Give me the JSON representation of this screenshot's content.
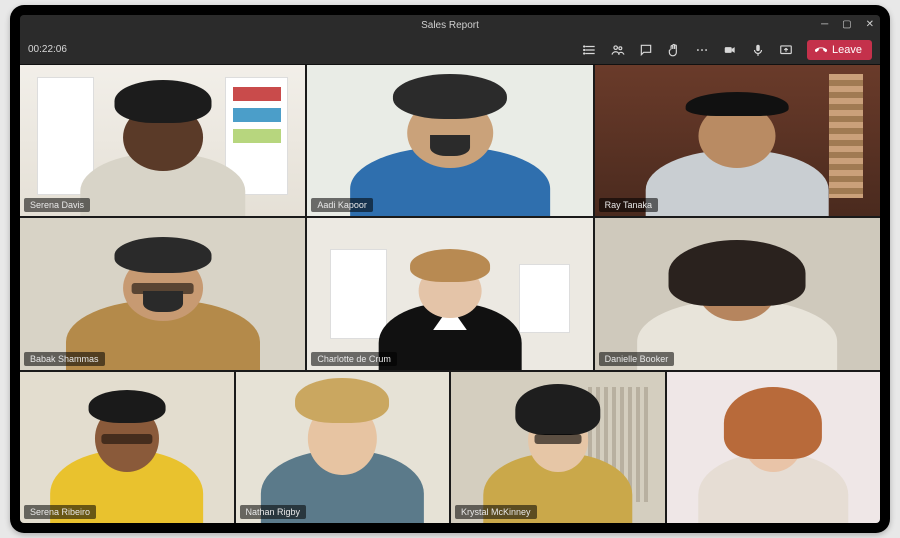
{
  "meeting": {
    "title": "Sales Report",
    "elapsed": "00:22:06",
    "leave_label": "Leave"
  },
  "participants": [
    {
      "name": "Serena Davis"
    },
    {
      "name": "Aadi Kapoor"
    },
    {
      "name": "Ray Tanaka"
    },
    {
      "name": "Babak Shammas"
    },
    {
      "name": "Charlotte de Crum"
    },
    {
      "name": "Danielle Booker"
    },
    {
      "name": "Serena Ribeiro"
    },
    {
      "name": "Nathan Rigby"
    },
    {
      "name": "Krystal McKinney"
    },
    {
      "name": ""
    }
  ]
}
